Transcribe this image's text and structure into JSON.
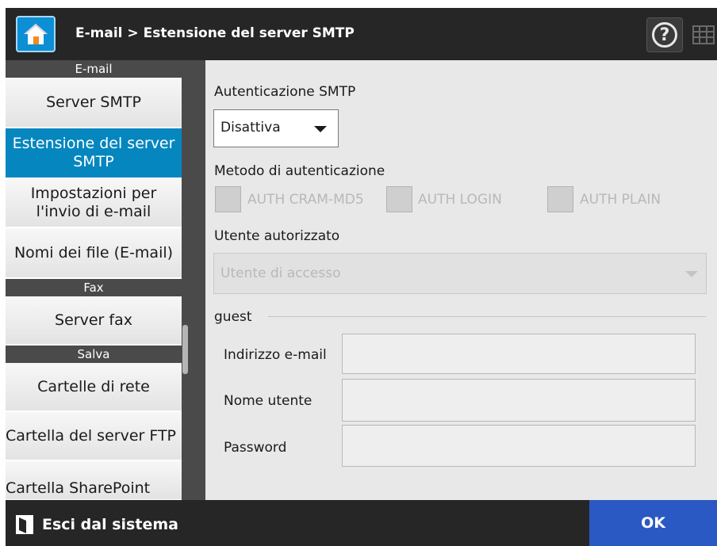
{
  "header": {
    "title": "E-mail > Estensione del server SMTP",
    "home_icon": "home-icon",
    "help_glyph": "?",
    "help_icon": "help-icon",
    "keyboard_icon": "keyboard-icon"
  },
  "sidebar": {
    "sections": [
      {
        "label": "E-mail"
      },
      {
        "label": "Fax"
      },
      {
        "label": "Salva"
      }
    ],
    "items": [
      {
        "label": "Server SMTP"
      },
      {
        "label": "Estensione del server SMTP"
      },
      {
        "label": "Impostazioni per l'invio di e-mail"
      },
      {
        "label": "Nomi dei file (E-mail)"
      },
      {
        "label": "Server fax"
      },
      {
        "label": "Cartelle di rete"
      },
      {
        "label": "Cartella del server FTP"
      },
      {
        "label": "Cartella SharePoint"
      }
    ]
  },
  "form": {
    "smtp_auth_label": "Autenticazione SMTP",
    "smtp_auth_value": "Disattiva",
    "auth_method_label": "Metodo di autenticazione",
    "auth_options": [
      {
        "label": "AUTH CRAM-MD5",
        "checked": false
      },
      {
        "label": "AUTH LOGIN",
        "checked": false
      },
      {
        "label": "AUTH PLAIN",
        "checked": false
      }
    ],
    "authorized_user_label": "Utente autorizzato",
    "authorized_user_value": "Utente di accesso",
    "guest_label": "guest",
    "email_label": "Indirizzo e-mail",
    "email_value": "",
    "username_label": "Nome utente",
    "username_value": "",
    "password_label": "Password",
    "password_value": ""
  },
  "footer": {
    "logout_label": "Esci dal sistema",
    "logout_icon": "logout-icon",
    "ok_label": "OK"
  },
  "colors": {
    "header_bg": "#262626",
    "accent": "#0586bf",
    "ok_button": "#2b59c3"
  }
}
